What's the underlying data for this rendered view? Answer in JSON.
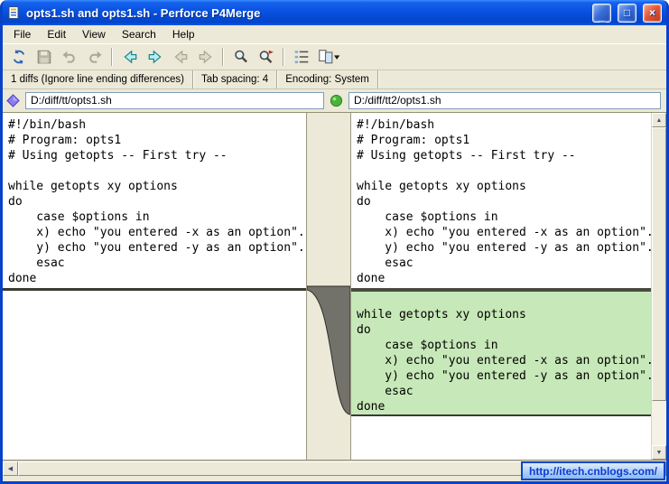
{
  "window": {
    "title": "opts1.sh and opts1.sh - Perforce P4Merge",
    "minimize_glyph": "_",
    "maximize_glyph": "□",
    "close_glyph": "×"
  },
  "menu": {
    "items": [
      "File",
      "Edit",
      "View",
      "Search",
      "Help"
    ]
  },
  "toolbar": {
    "icons": [
      "refresh-diff",
      "save",
      "undo",
      "redo",
      "prev-diff",
      "next-diff",
      "prev-conflict",
      "next-conflict",
      "find",
      "find-next",
      "line-numbers",
      "diff-layout-dropdown"
    ]
  },
  "infobar": {
    "diffs": "1 diffs (Ignore line ending differences)",
    "tab_spacing": "Tab spacing: 4",
    "encoding": "Encoding: System"
  },
  "panes": {
    "left": {
      "path": "D:/diff/tt/opts1.sh",
      "marker": "blue-diamond"
    },
    "right": {
      "path": "D:/diff/tt2/opts1.sh",
      "marker": "green-circle"
    }
  },
  "code": {
    "lines": [
      "#!/bin/bash",
      "# Program: opts1",
      "# Using getopts -- First try --",
      "",
      "while getopts xy options",
      "do",
      "    case $options in",
      "    x) echo \"you entered -x as an option\".",
      "    y) echo \"you entered -y as an option\".",
      "    esac",
      "done"
    ],
    "added": [
      "",
      "while getopts xy options",
      "do",
      "    case $options in",
      "    x) echo \"you entered -x as an option\".",
      "    y) echo \"you entered -y as an option\".",
      "    esac",
      "done"
    ]
  },
  "scrollbar": {
    "up": "▲",
    "down": "▼",
    "left": "◀",
    "right": "▶"
  },
  "watermark": {
    "text": "http://itech.cnblogs.com/"
  },
  "colors": {
    "titlebar_blue": "#0a51e0",
    "window_bg": "#ece9d8",
    "added_bg": "#c7e8b8",
    "connector_gray": "#72726a",
    "marker_left": "#8a7bf0",
    "marker_right": "#49b43a",
    "watermark_border": "#0846c8"
  }
}
